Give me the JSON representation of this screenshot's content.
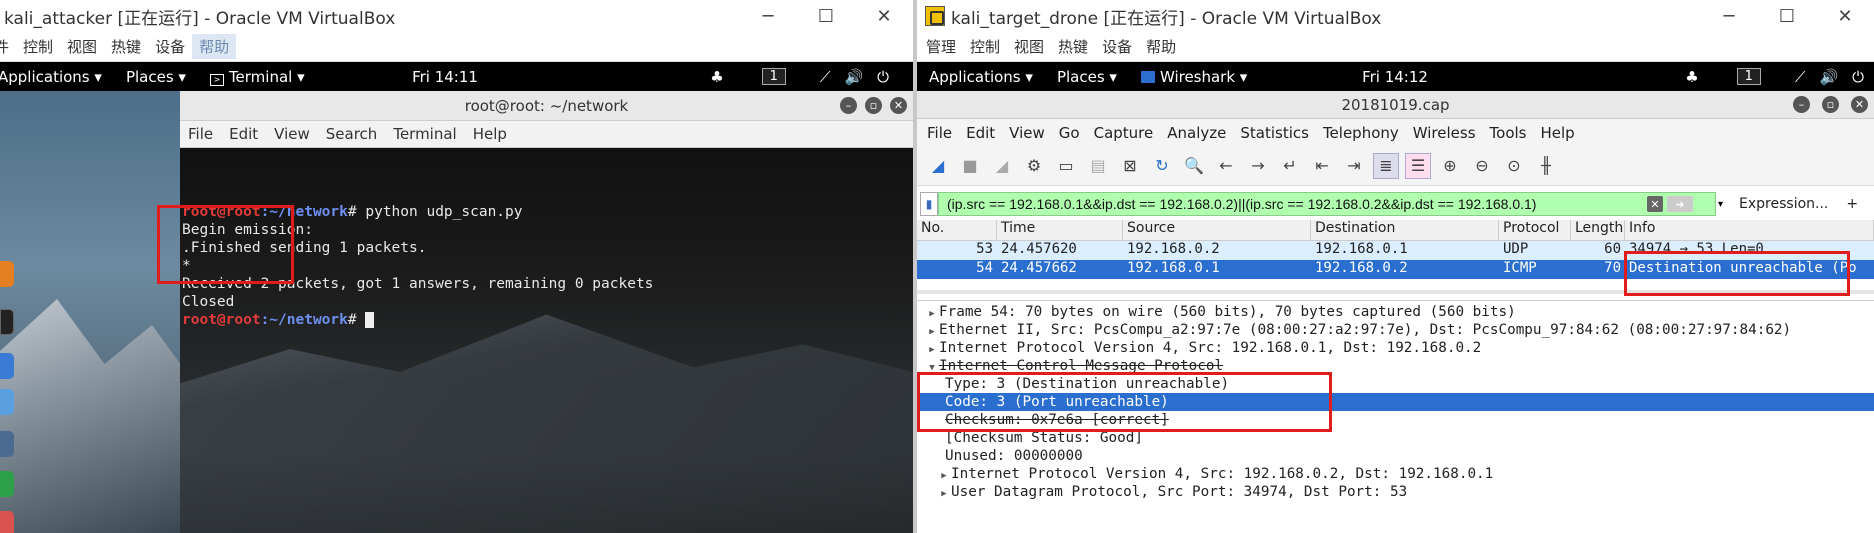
{
  "left_window": {
    "title": "kali_attacker [正在运行] - Oracle VM VirtualBox",
    "menu": [
      "控制",
      "视图",
      "热键",
      "设备",
      "帮助"
    ],
    "menu_partial_first": "件",
    "gnome_bar": {
      "applications": "Applications ▾",
      "places": "Places ▾",
      "terminal": "Terminal ▾",
      "clock": "Fri 14:11",
      "workspace": "1"
    },
    "terminal": {
      "title": "root@root: ~/network",
      "menu": [
        "File",
        "Edit",
        "View",
        "Search",
        "Terminal",
        "Help"
      ],
      "prompt_user": "root@root",
      "prompt_path": ":~/network",
      "prompt_hash": "#",
      "command": " python udp_scan.py",
      "lines": [
        "Begin emission:",
        ".Finished sending 1 packets.",
        "*",
        "Received 2 packets, got 1 answers, remaining 0 packets",
        "Closed"
      ]
    }
  },
  "right_window": {
    "title": "kali_target_drone [正在运行] - Oracle VM VirtualBox",
    "menu": [
      "管理",
      "控制",
      "视图",
      "热键",
      "设备",
      "帮助"
    ],
    "gnome_bar": {
      "applications": "Applications ▾",
      "places": "Places ▾",
      "wireshark": "Wireshark ▾",
      "clock": "Fri 14:12",
      "workspace": "1"
    },
    "wireshark": {
      "title": "20181019.cap",
      "menu": [
        "File",
        "Edit",
        "View",
        "Go",
        "Capture",
        "Analyze",
        "Statistics",
        "Telephony",
        "Wireless",
        "Tools",
        "Help"
      ],
      "filter": "(ip.src == 192.168.0.1&&ip.dst == 192.168.0.2)||(ip.src == 192.168.0.2&&ip.dst == 192.168.0.1)",
      "expression_label": "Expression...",
      "plus_label": "+",
      "columns": [
        "No.",
        "Time",
        "Source",
        "Destination",
        "Protocol",
        "Length",
        "Info"
      ],
      "packets": [
        [
          "53",
          "24.457620",
          "192.168.0.2",
          "192.168.0.1",
          "UDP",
          "60",
          "34974 → 53 Len=0"
        ],
        [
          "54",
          "24.457662",
          "192.168.0.1",
          "192.168.0.2",
          "ICMP",
          "70",
          "Destination unreachable (Po"
        ]
      ],
      "details": [
        "Frame 54: 70 bytes on wire (560 bits), 70 bytes captured (560 bits)",
        "Ethernet II, Src: PcsCompu_a2:97:7e (08:00:27:a2:97:7e), Dst: PcsCompu_97:84:62 (08:00:27:97:84:62)",
        "Internet Protocol Version 4, Src: 192.168.0.1, Dst: 192.168.0.2",
        "Internet Control Message Protocol",
        "Type: 3 (Destination unreachable)",
        "Code: 3 (Port unreachable)",
        "Checksum: 0x7e6a [correct]",
        "[Checksum Status: Good]",
        "Unused: 00000000",
        "Internet Protocol Version 4, Src: 192.168.0.2, Dst: 192.168.0.1",
        "User Datagram Protocol, Src Port: 34974, Dst Port: 53"
      ]
    }
  },
  "colors": {
    "highlight_box": "#e01c1c",
    "selection": "#2a6fcf",
    "filter_ok": "#afffaf",
    "prompt_red": "#e23b3b",
    "prompt_blue": "#6e8ff0"
  }
}
